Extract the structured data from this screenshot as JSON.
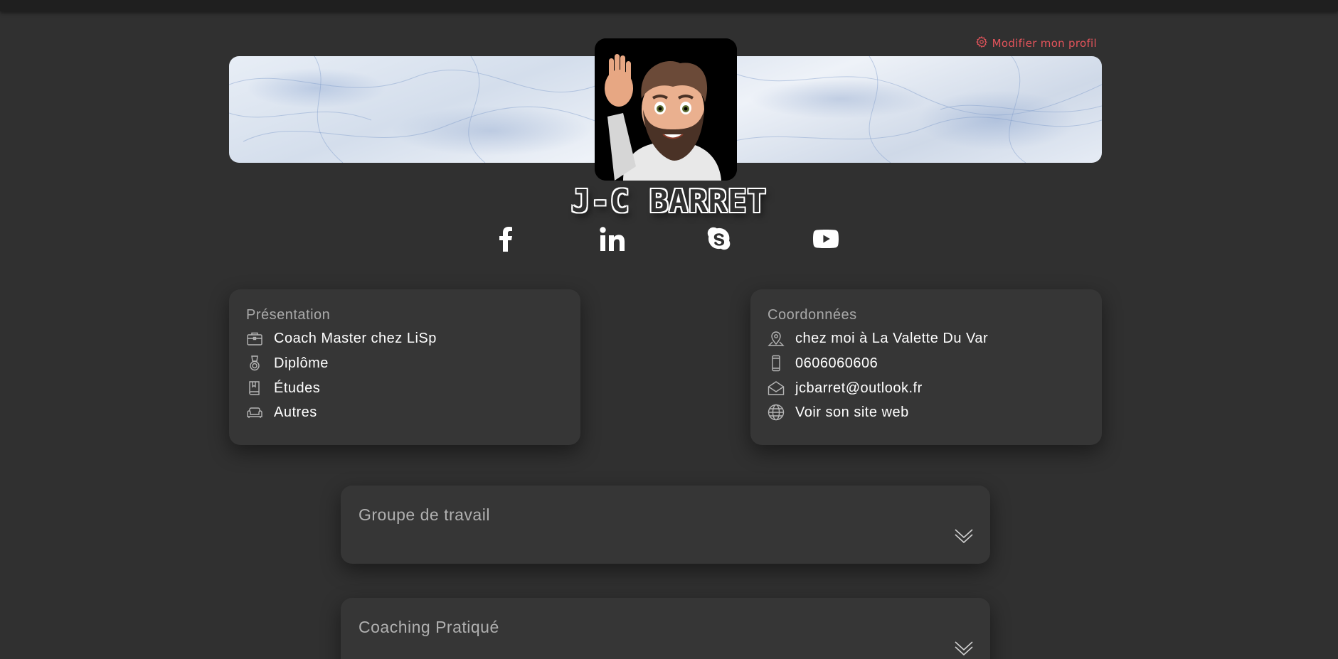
{
  "header": {
    "edit_profile_label": "Modifier mon profil"
  },
  "profile": {
    "name": "J-C BARRET"
  },
  "social": [
    {
      "icon": "facebook-icon"
    },
    {
      "icon": "linkedin-icon"
    },
    {
      "icon": "skype-icon"
    },
    {
      "icon": "youtube-icon"
    }
  ],
  "presentation": {
    "title": "Présentation",
    "items": [
      {
        "icon": "briefcase-icon",
        "label": "Coach Master chez LiSp"
      },
      {
        "icon": "medal-icon",
        "label": "Diplôme"
      },
      {
        "icon": "book-icon",
        "label": "Études"
      },
      {
        "icon": "sofa-icon",
        "label": "Autres"
      }
    ]
  },
  "coordinates": {
    "title": "Coordonnées",
    "items": [
      {
        "icon": "map-pin-icon",
        "label": "chez moi à La Valette Du Var"
      },
      {
        "icon": "phone-icon",
        "label": "0606060606"
      },
      {
        "icon": "mail-icon",
        "label": "jcbarret@outlook.fr"
      },
      {
        "icon": "globe-icon",
        "label": "Voir son site web"
      }
    ]
  },
  "sections": [
    {
      "title": "Groupe de travail"
    },
    {
      "title": "Coaching Pratiqué"
    }
  ],
  "colors": {
    "background": "#303030",
    "card": "#363636",
    "accent": "#e4545b"
  }
}
